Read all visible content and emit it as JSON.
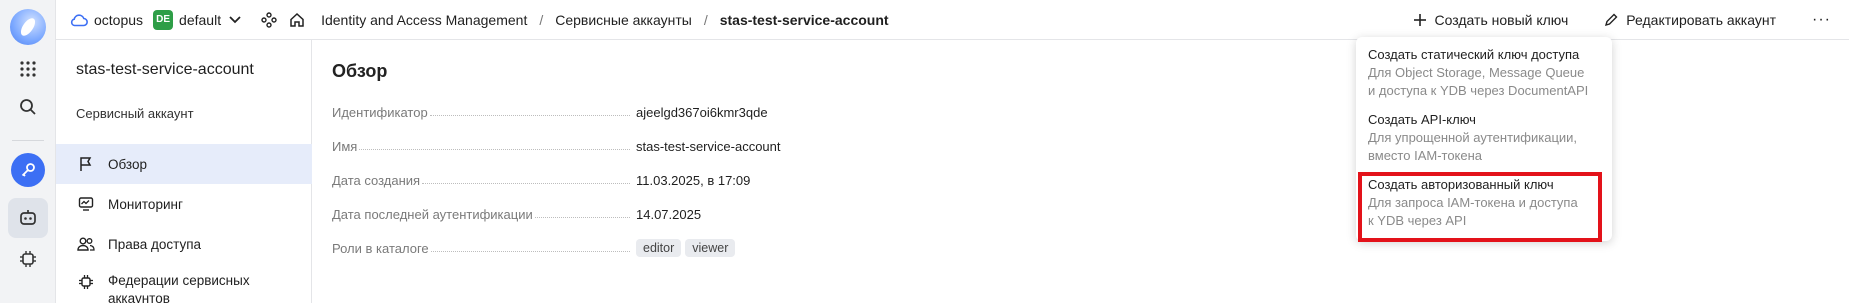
{
  "rail": {
    "icons": [
      "logo",
      "apps-grid-icon",
      "search-icon",
      "key-icon",
      "robot-icon",
      "chip-icon"
    ]
  },
  "topbar": {
    "cloud": "octopus",
    "folder_badge": "DE",
    "folder": "default",
    "crumbs": [
      "Identity and Access Management",
      "Сервисные аккаунты",
      "stas-test-service-account"
    ],
    "create_key": "Создать новый ключ",
    "edit_account": "Редактировать аккаунт",
    "more": "···"
  },
  "sidebar": {
    "title": "stas-test-service-account",
    "subtitle": "Сервисный аккаунт",
    "items": [
      {
        "label": "Обзор",
        "icon": "flag-icon",
        "active": true
      },
      {
        "label": "Мониторинг",
        "icon": "monitor-icon",
        "active": false
      },
      {
        "label": "Права доступа",
        "icon": "users-icon",
        "active": false
      },
      {
        "label": "Федерации сервисных аккаунтов",
        "icon": "federation-icon",
        "active": false
      }
    ]
  },
  "main": {
    "title": "Обзор",
    "fields": [
      {
        "label": "Идентификатор",
        "value": "ajeelgd367oi6kmr3qde"
      },
      {
        "label": "Имя",
        "value": "stas-test-service-account"
      },
      {
        "label": "Дата создания",
        "value": "11.03.2025, в 17:09"
      },
      {
        "label": "Дата последней аутентификации",
        "value": "14.07.2025"
      },
      {
        "label": "Роли в каталоге",
        "value": ""
      }
    ],
    "roles": [
      "editor",
      "viewer"
    ]
  },
  "menu": {
    "items": [
      {
        "title": "Создать статический ключ доступа",
        "desc1": "Для Object Storage, Message Queue",
        "desc2": "и доступа к YDB через DocumentAPI"
      },
      {
        "title": "Создать API-ключ",
        "desc1": "Для упрощенной аутентификации,",
        "desc2": "вместо IAM-токена"
      },
      {
        "title": "Создать авторизованный ключ",
        "desc1": "Для запроса IAM-токена и доступа",
        "desc2": "к YDB через API"
      }
    ],
    "highlight_color": "#e3121a"
  }
}
